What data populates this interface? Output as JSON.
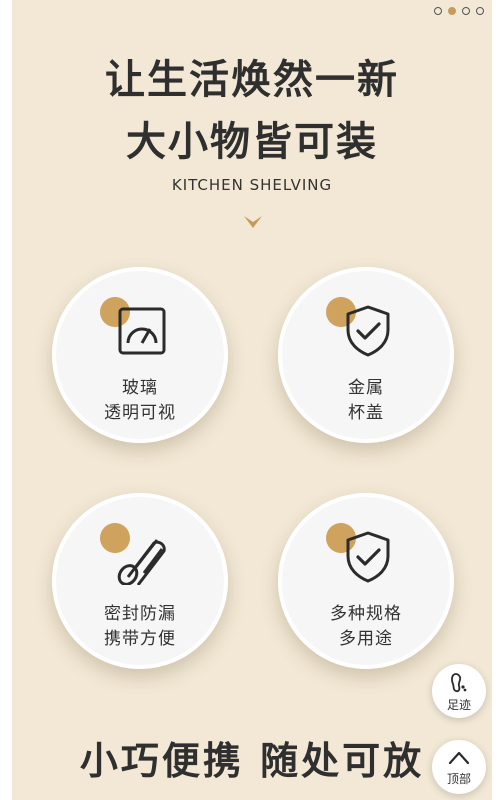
{
  "pager": {
    "total": 4,
    "active_index": 1
  },
  "headline": {
    "line1": "让生活焕然一新",
    "line2": "大小物皆可装"
  },
  "subtitle": "KITCHEN SHELVING",
  "features": [
    {
      "icon": "gauge-icon",
      "line1": "玻璃",
      "line2": "透明可视"
    },
    {
      "icon": "shield-check-icon",
      "line1": "金属",
      "line2": "杯盖"
    },
    {
      "icon": "seal-roll-icon",
      "line1": "密封防漏",
      "line2": "携带方便"
    },
    {
      "icon": "shield-check-icon",
      "line1": "多种规格",
      "line2": "多用途"
    }
  ],
  "bottom_slogan": "小巧便携 随处可放",
  "floating": {
    "footprint_label": "足迹",
    "top_label": "顶部"
  },
  "colors": {
    "background": "#f2e8d5",
    "accent": "#cfa25e",
    "text": "#2f2f2f"
  }
}
